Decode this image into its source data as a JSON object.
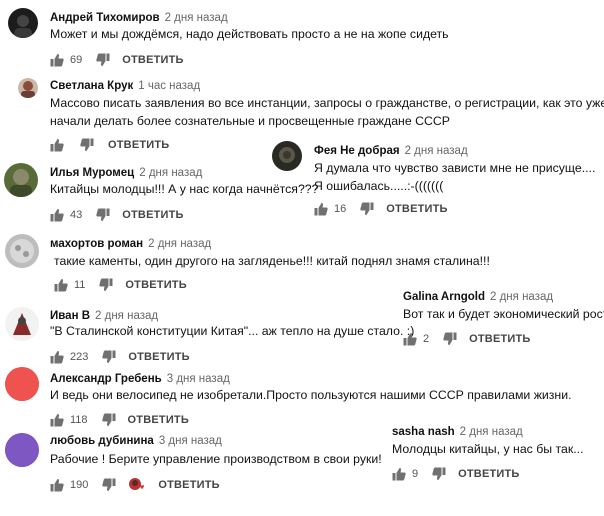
{
  "reply_label": "ОТВЕТИТЬ",
  "colors": {
    "like_icon": "#707070",
    "author": "#111111",
    "time": "#666666",
    "text": "#111111",
    "heart": "#e0303a"
  },
  "icons": {
    "like": "thumb-up-icon",
    "dislike": "thumb-down-icon",
    "heart": "heart-icon"
  },
  "comments": [
    {
      "author": "Андрей Тихомиров",
      "time": "2 дня назад",
      "lines": [
        "Может и мы дождёмся, надо действовать просто а не на жопе сидеть"
      ],
      "likes": "69"
    },
    {
      "author": "Светлана Крук",
      "time": "1 час назад",
      "lines": [
        "Массово писать заявления во все инстанции, запросы о гражданстве, о регистрации, как это уже",
        "начали делать более сознательные и просвещенные граждане СССР"
      ],
      "likes": ""
    },
    {
      "author": "Илья Муромец",
      "time": "2 дня назад",
      "lines": [
        "Китайцы молодцы!!! А у нас когда начнётся???"
      ],
      "likes": "43"
    },
    {
      "author": "Фея Не добрая",
      "time": "2 дня назад",
      "lines": [
        "Я думала что чувство зависти мне не присуще....",
        "Я ошибалась.....:-((((((("
      ],
      "likes": "16"
    },
    {
      "author": "махортов роман",
      "time": "2 дня назад",
      "lines": [
        "такие каменты, один другого на загляденье!!! китай поднял знамя сталина!!!"
      ],
      "likes": "11"
    },
    {
      "author": "Иван В",
      "time": "2 дня назад",
      "lines": [
        "\"В Сталинской конституции Китая\"... аж тепло на душе стало. :)"
      ],
      "likes": "223"
    },
    {
      "author": "Galina Arngold",
      "time": "2 дня назад",
      "lines": [
        "Вот так и будет экономический рост"
      ],
      "likes": "2"
    },
    {
      "author": "Александр Гребень",
      "time": "3 дня назад",
      "lines": [
        "И ведь они велосипед не изобретали.Просто пользуются нашими СССР правилами жизни."
      ],
      "likes": "118"
    },
    {
      "author": "любовь дубинина",
      "time": "3 дня назад",
      "lines": [
        "Рабочие  ! Берите  управление  производством  в  свои  руки!"
      ],
      "likes": "190"
    },
    {
      "author": "sasha nash",
      "time": "2 дня назад",
      "lines": [
        "Молодцы китайцы, у нас бы так..."
      ],
      "likes": "9"
    }
  ]
}
